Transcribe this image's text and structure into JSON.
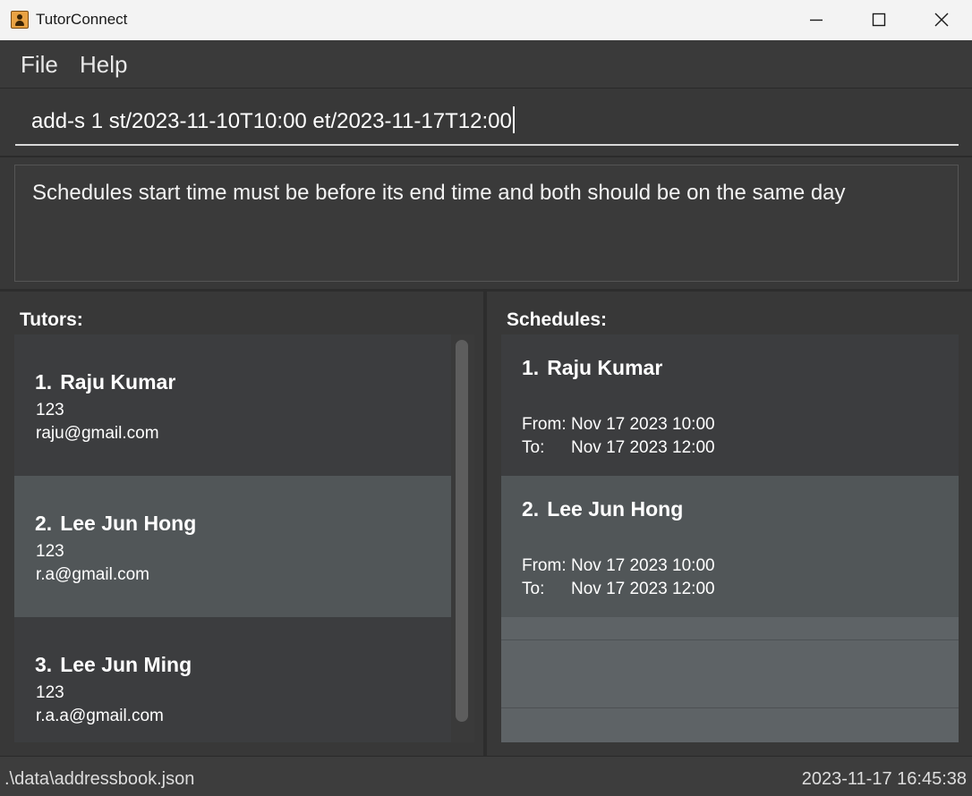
{
  "window": {
    "title": "TutorConnect"
  },
  "menu": {
    "items": [
      "File",
      "Help"
    ]
  },
  "command": {
    "value": "add-s 1 st/2023-11-10T10:00 et/2023-11-17T12:00"
  },
  "result": {
    "message": "Schedules start time must be before its end time and both should be on the same day"
  },
  "tutors": {
    "label": "Tutors:",
    "items": [
      {
        "index": "1.",
        "name": "Raju Kumar",
        "phone": "123",
        "email": "raju@gmail.com"
      },
      {
        "index": "2.",
        "name": "Lee Jun Hong",
        "phone": "123",
        "email": "r.a@gmail.com"
      },
      {
        "index": "3.",
        "name": "Lee Jun Ming",
        "phone": "123",
        "email": "r.a.a@gmail.com"
      }
    ]
  },
  "schedules": {
    "label": "Schedules:",
    "from_label": "From:",
    "to_label": "To:",
    "items": [
      {
        "index": "1.",
        "name": "Raju Kumar",
        "from": "Nov 17 2023 10:00",
        "to": "Nov 17 2023 12:00"
      },
      {
        "index": "2.",
        "name": "Lee Jun Hong",
        "from": "Nov 17 2023 10:00",
        "to": "Nov 17 2023 12:00"
      }
    ]
  },
  "status": {
    "path": ".\\data\\addressbook.json",
    "timestamp": "2023-11-17 16:45:38"
  },
  "icons": {
    "app": "person-card-icon",
    "minimize": "minimize-icon",
    "maximize": "maximize-icon",
    "close": "close-icon"
  },
  "colors": {
    "background": "#383838",
    "card_dark": "#3c3d3f",
    "card_selected": "#515658",
    "titlebar": "#f3f3f3"
  }
}
